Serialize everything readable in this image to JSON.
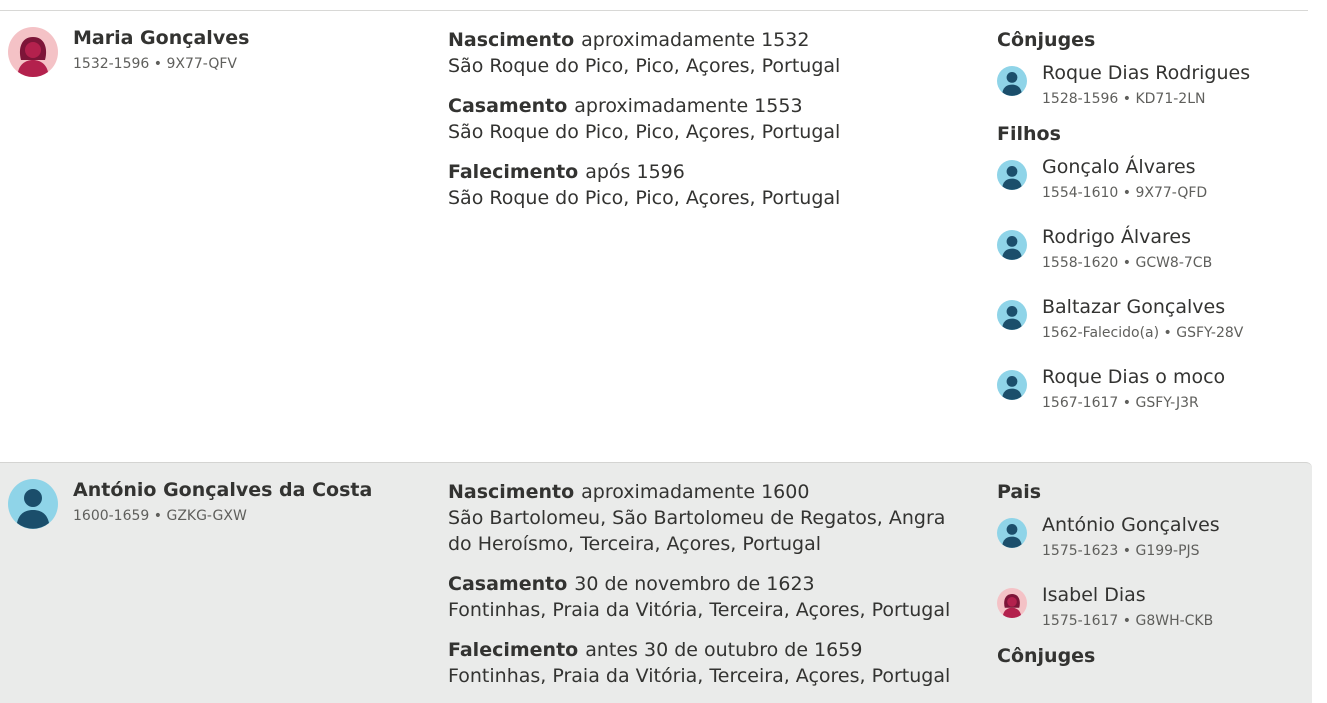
{
  "records": [
    {
      "person": {
        "name": "Maria Gonçalves",
        "meta": "1532-1596 • 9X77-QFV",
        "avatar": "female-avatar-icon"
      },
      "events": [
        {
          "type": "Nascimento",
          "date": "aproximadamente 1532",
          "place": "São Roque do Pico, Pico, Açores, Portugal"
        },
        {
          "type": "Casamento",
          "date": "aproximadamente 1553",
          "place": "São Roque do Pico, Pico, Açores, Portugal"
        },
        {
          "type": "Falecimento",
          "date": "após 1596",
          "place": "São Roque do Pico, Pico, Açores, Portugal"
        }
      ],
      "relatives": {
        "spouses_heading": "Cônjuges",
        "spouses": [
          {
            "name": "Roque Dias Rodrigues",
            "meta": "1528-1596 • KD71-2LN",
            "avatar": "male-avatar-icon"
          }
        ],
        "children_heading": "Filhos",
        "children": [
          {
            "name": "Gonçalo Álvares",
            "meta": "1554-1610 • 9X77-QFD",
            "avatar": "male-avatar-icon"
          },
          {
            "name": "Rodrigo Álvares",
            "meta": "1558-1620 • GCW8-7CB",
            "avatar": "male-avatar-icon"
          },
          {
            "name": "Baltazar Gonçalves",
            "meta": "1562-Falecido(a) • GSFY-28V",
            "avatar": "male-avatar-icon"
          },
          {
            "name": "Roque Dias o moco",
            "meta": "1567-1617 • GSFY-J3R",
            "avatar": "male-avatar-icon"
          }
        ]
      }
    },
    {
      "person": {
        "name": "António Gonçalves da Costa",
        "meta": "1600-1659 • GZKG-GXW",
        "avatar": "male-avatar-icon"
      },
      "events": [
        {
          "type": "Nascimento",
          "date": "aproximadamente 1600",
          "place": "São Bartolomeu, São Bartolomeu de Regatos, Angra do Heroísmo, Terceira, Açores, Portugal"
        },
        {
          "type": "Casamento",
          "date": "30 de novembro de 1623",
          "place": "Fontinhas, Praia da Vitória, Terceira, Açores, Portugal"
        },
        {
          "type": "Falecimento",
          "date": "antes 30 de outubro de 1659",
          "place": "Fontinhas, Praia da Vitória, Terceira, Açores, Portugal"
        }
      ],
      "relatives": {
        "parents_heading": "Pais",
        "parents": [
          {
            "name": "António Gonçalves",
            "meta": "1575-1623 • G199-PJS",
            "avatar": "male-avatar-icon"
          },
          {
            "name": "Isabel Dias",
            "meta": "1575-1617 • G8WH-CKB",
            "avatar": "female-avatar-icon"
          }
        ],
        "spouses_heading": "Cônjuges"
      }
    }
  ],
  "colors": {
    "text": "#333331",
    "meta": "#5f5f5c",
    "highlight_bg": "#eaebea",
    "male_bg": "#8fd4e8",
    "male_fg": "#1b4e6b",
    "female_bg": "#f4c2c6",
    "female_fg": "#b3214d"
  }
}
